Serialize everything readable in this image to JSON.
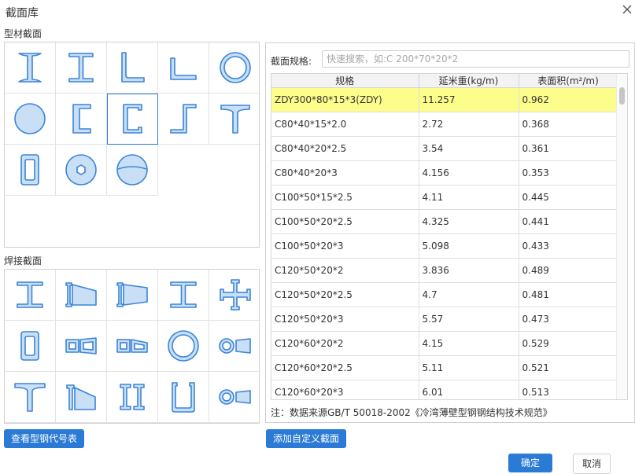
{
  "window": {
    "title": "截面库"
  },
  "sections": {
    "profile_label": "型材截面",
    "welded_label": "焊接截面",
    "profile_shapes": [
      "i-beam-icon",
      "h-beam-icon",
      "angle-icon",
      "unequal-angle-icon",
      "round-tube-icon",
      "solid-round-icon",
      "channel-icon",
      "lipped-channel-icon",
      "z-section-icon",
      "tee-icon",
      "rect-tube-icon",
      "hex-bar-icon",
      "split-round-icon"
    ],
    "welded_shapes": [
      "welded-i-icon",
      "tapered-i-left-icon",
      "tapered-i-right-icon",
      "welded-h-icon",
      "cross-section-icon",
      "welded-box-icon",
      "tapered-box-icon",
      "tapered-box-2-icon",
      "welded-pipe-icon",
      "tapered-pipe-icon",
      "welded-tee-icon",
      "tapered-tee-icon",
      "double-channel-icon",
      "u-section-icon",
      "tapered-pipe-2-icon"
    ]
  },
  "search": {
    "label": "截面规格:",
    "placeholder": "快速搜索，如:C 200*70*20*2"
  },
  "table": {
    "headers": [
      "规格",
      "延米重(kg/m)",
      "表面积(m²/m)"
    ],
    "rows": [
      [
        "ZDY300*80*15*3(ZDY)",
        "11.257",
        "0.962"
      ],
      [
        "C80*40*15*2.0",
        "2.72",
        "0.368"
      ],
      [
        "C80*40*20*2.5",
        "3.54",
        "0.361"
      ],
      [
        "C80*40*20*3",
        "4.156",
        "0.353"
      ],
      [
        "C100*50*15*2.5",
        "4.11",
        "0.445"
      ],
      [
        "C100*50*20*2.5",
        "4.325",
        "0.441"
      ],
      [
        "C100*50*20*3",
        "5.098",
        "0.433"
      ],
      [
        "C120*50*20*2",
        "3.836",
        "0.489"
      ],
      [
        "C120*50*20*2.5",
        "4.7",
        "0.481"
      ],
      [
        "C120*50*20*3",
        "5.57",
        "0.473"
      ],
      [
        "C120*60*20*2",
        "4.15",
        "0.529"
      ],
      [
        "C120*60*20*2.5",
        "5.11",
        "0.521"
      ],
      [
        "C120*60*20*3",
        "6.01",
        "0.513"
      ]
    ]
  },
  "note": "注：数据来源GB/T 50018-2002《冷湾薄壁型钢钢结构技术规范》",
  "buttons": {
    "view_codes": "查看型钢代号表",
    "add_custom": "添加自定义截面",
    "ok": "确定",
    "cancel": "取消"
  },
  "colors": {
    "accent": "#2b7bd6",
    "highlight_row": "#fdfd8c",
    "icon_fill": "#c9dff5",
    "icon_stroke": "#3a84d8"
  }
}
